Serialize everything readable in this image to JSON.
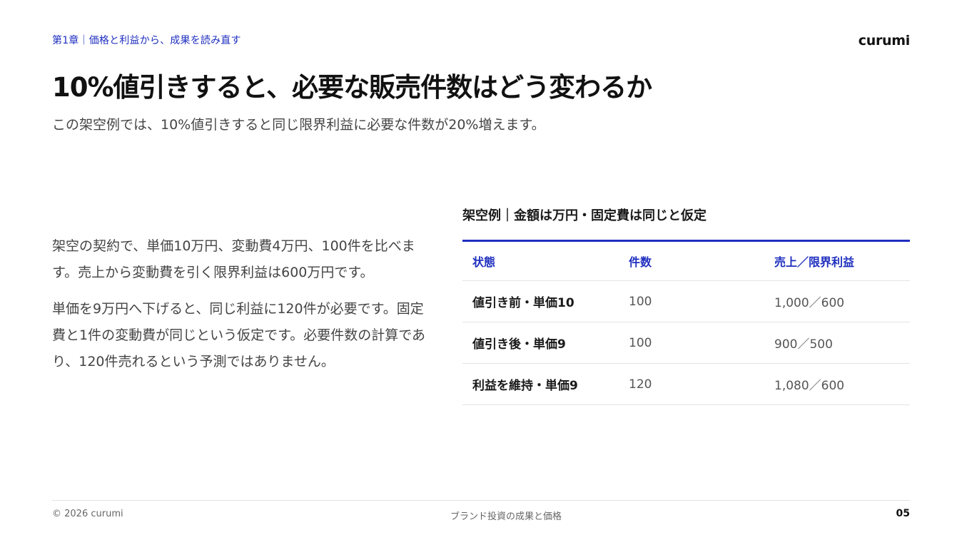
{
  "header": {
    "chapter": "第1章｜価格と利益から、成果を読み直す",
    "brand": "curumi"
  },
  "title": "10%値引きすると、必要な販売件数はどう変わるか",
  "subtitle": "この架空例では、10%値引きすると同じ限界利益に必要な件数が20%増えます。",
  "body": {
    "paragraph1": "架空の契約で、単価10万円、変動費4万円、100件を比べます。売上から変動費を引く限界利益は600万円です。",
    "paragraph2": "単価を9万円へ下げると、同じ利益に120件が必要です。固定費と1件の変動費が同じという仮定です。必要件数の計算であり、120件売れるという予測ではありません。"
  },
  "table": {
    "caption": "架空例｜金額は万円・固定費は同じと仮定",
    "headers": [
      "状態",
      "件数",
      "売上／限界利益"
    ],
    "rows": [
      [
        "値引き前・単価10",
        "100",
        "1,000／600"
      ],
      [
        "値引き後・単価9",
        "100",
        "900／500"
      ],
      [
        "利益を維持・単価9",
        "120",
        "1,080／600"
      ]
    ]
  },
  "footer": {
    "copyright": "© 2026 curumi",
    "center": "ブランド投資の成果と価格",
    "page": "05"
  },
  "colors": {
    "accent": "#1f2fbf"
  }
}
